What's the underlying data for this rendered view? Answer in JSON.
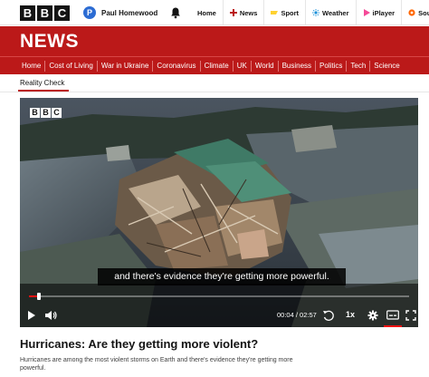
{
  "topbar": {
    "logo_letters": [
      "B",
      "B",
      "C"
    ],
    "account": {
      "initial": "P",
      "name": "Paul Homewood"
    },
    "nav": [
      {
        "label": "Home",
        "icon": ""
      },
      {
        "label": "News",
        "icon": "news-icon",
        "icon_color": "#bb1919"
      },
      {
        "label": "Sport",
        "icon": "sport-icon",
        "icon_color": "#ffd230"
      },
      {
        "label": "Weather",
        "icon": "weather-icon",
        "icon_color": "#1a8fd8"
      },
      {
        "label": "iPlayer",
        "icon": "iplayer-icon",
        "icon_color": "#f54997"
      },
      {
        "label": "Sounds",
        "icon": "sounds-icon",
        "icon_color": "#ff6600"
      }
    ]
  },
  "news": {
    "title": "NEWS",
    "brand_color": "#bb1919",
    "nav": [
      "Home",
      "Cost of Living",
      "War in Ukraine",
      "Coronavirus",
      "Climate",
      "UK",
      "World",
      "Business",
      "Politics",
      "Tech",
      "Science"
    ]
  },
  "subsection": {
    "label": "Reality Check"
  },
  "video": {
    "logo_letters": [
      "B",
      "B",
      "C"
    ],
    "caption": "and there's evidence they're getting more powerful.",
    "progress_fraction": 0.026,
    "time": "00:04 / 02:57",
    "speed": "1x"
  },
  "article": {
    "headline": "Hurricanes: Are they getting more violent?",
    "summary": "Hurricanes are among the most violent storms on Earth and there's evidence they're getting more powerful."
  }
}
